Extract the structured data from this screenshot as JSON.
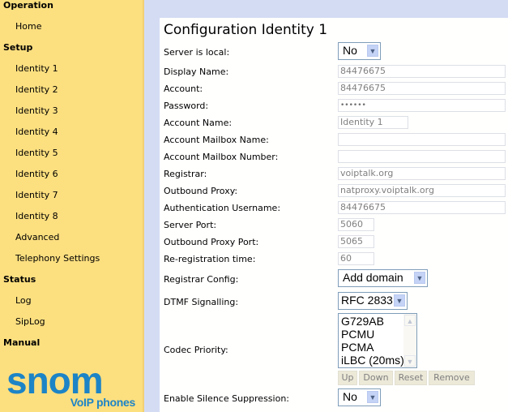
{
  "sidebar": {
    "sections": [
      {
        "title": "Operation",
        "items": [
          "Home"
        ]
      },
      {
        "title": "Setup",
        "items": [
          "Identity 1",
          "Identity 2",
          "Identity 3",
          "Identity 4",
          "Identity 5",
          "Identity 6",
          "Identity 7",
          "Identity 8",
          "Advanced",
          "Telephony Settings"
        ]
      },
      {
        "title": "Status",
        "items": [
          "Log",
          "SipLog"
        ]
      },
      {
        "title": "Manual",
        "items": []
      }
    ],
    "logo": {
      "brand": "snom",
      "tagline": "VoIP phones"
    }
  },
  "page": {
    "title": "Configuration Identity 1",
    "fields": {
      "server_is_local": {
        "label": "Server is local:",
        "value": "No"
      },
      "display_name": {
        "label": "Display Name:",
        "value": "84476675"
      },
      "account": {
        "label": "Account:",
        "value": "84476675"
      },
      "password": {
        "label": "Password:",
        "value": "••••••"
      },
      "account_name": {
        "label": "Account Name:",
        "value": "Identity 1"
      },
      "mailbox_name": {
        "label": "Account Mailbox Name:",
        "value": ""
      },
      "mailbox_number": {
        "label": "Account Mailbox Number:",
        "value": ""
      },
      "registrar": {
        "label": "Registrar:",
        "value": "voiptalk.org"
      },
      "outbound_proxy": {
        "label": "Outbound Proxy:",
        "value": "natproxy.voiptalk.org"
      },
      "auth_username": {
        "label": "Authentication Username:",
        "value": "84476675"
      },
      "server_port": {
        "label": "Server Port:",
        "value": "5060"
      },
      "outbound_proxy_port": {
        "label": "Outbound Proxy Port:",
        "value": "5065"
      },
      "reregistration_time": {
        "label": "Re-registration time:",
        "value": "60"
      },
      "registrar_config": {
        "label": "Registrar Config:",
        "value": "Add domain"
      },
      "dtmf_signalling": {
        "label": "DTMF Signalling:",
        "value": "RFC 2833"
      },
      "codec_priority": {
        "label": "Codec Priority:",
        "options": [
          "G729AB",
          "PCMU",
          "PCMA",
          "iLBC (20ms)"
        ]
      },
      "silence_suppression": {
        "label": "Enable Silence Suppression:",
        "value": "No"
      }
    },
    "codec_buttons": {
      "up": "Up",
      "down": "Down",
      "reset": "Reset",
      "remove": "Remove"
    }
  }
}
